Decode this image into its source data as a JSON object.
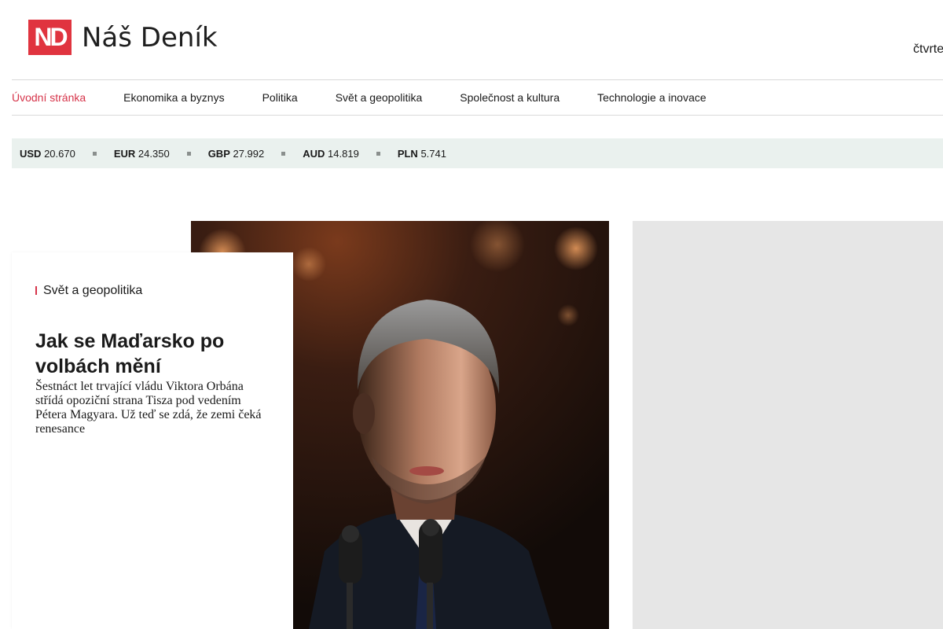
{
  "header": {
    "logo_mark": "ND",
    "logo_text": "Náš Deník",
    "date": "čtvrte"
  },
  "nav": {
    "items": [
      {
        "label": "Úvodní stránka",
        "active": true
      },
      {
        "label": "Ekonomika a byznys"
      },
      {
        "label": "Politika"
      },
      {
        "label": "Svět a geopolitika"
      },
      {
        "label": "Společnost a kultura"
      },
      {
        "label": "Technologie a inovace"
      }
    ]
  },
  "currencies": [
    {
      "code": "USD",
      "value": "20.670"
    },
    {
      "code": "EUR",
      "value": "24.350"
    },
    {
      "code": "GBP",
      "value": "27.992"
    },
    {
      "code": "AUD",
      "value": "14.819"
    },
    {
      "code": "PLN",
      "value": "5.741"
    }
  ],
  "feature": {
    "category": "Svět a geopolitika",
    "title": "Jak se Maďarsko po volbách mění",
    "perex": "Šestnáct let trvající vládu Viktora Orbána střídá opoziční strana Tisza pod vedením Pétera Magyara. Už teď se zdá, že zemi čeká renesance"
  },
  "colors": {
    "brand": "#e0343f",
    "active_nav": "#d6344a",
    "currency_bg": "#eaf1ee",
    "ad_bg": "#e6e6e6"
  }
}
